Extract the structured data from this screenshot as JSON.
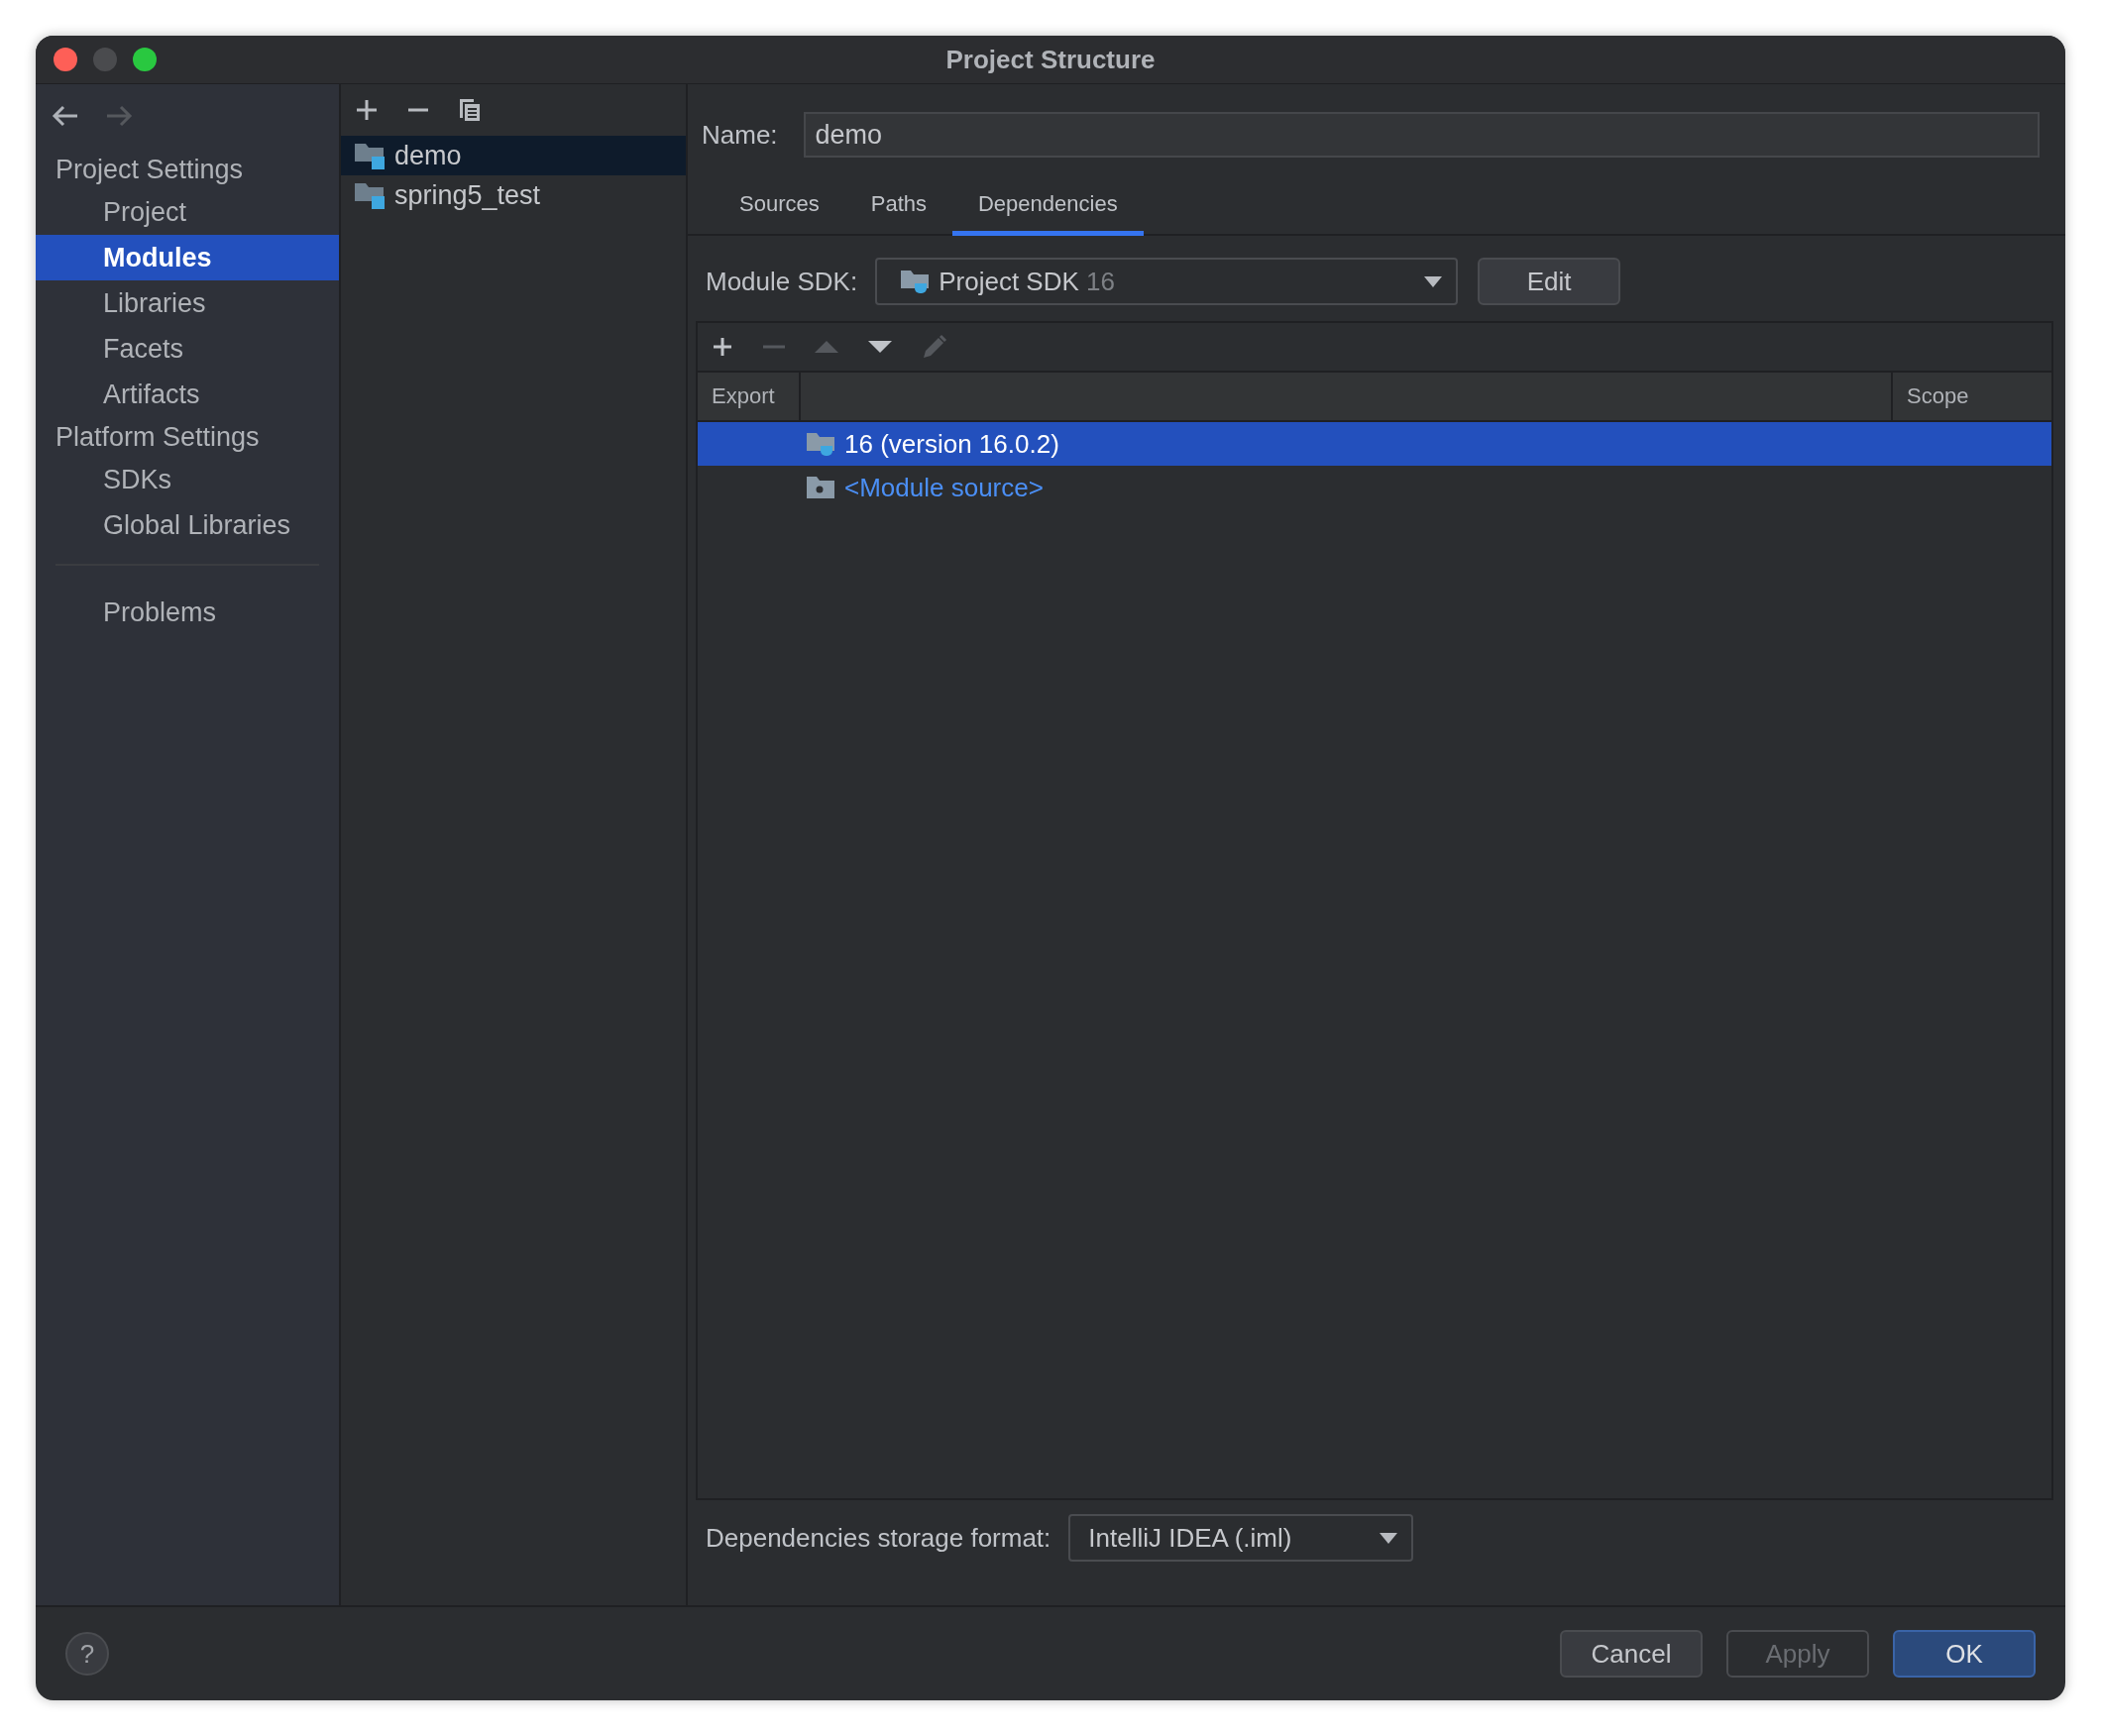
{
  "window": {
    "title": "Project Structure"
  },
  "sidebar": {
    "sections": [
      {
        "heading": "Project Settings",
        "items": [
          {
            "label": "Project",
            "selected": false
          },
          {
            "label": "Modules",
            "selected": true
          },
          {
            "label": "Libraries",
            "selected": false
          },
          {
            "label": "Facets",
            "selected": false
          },
          {
            "label": "Artifacts",
            "selected": false
          }
        ]
      },
      {
        "heading": "Platform Settings",
        "items": [
          {
            "label": "SDKs",
            "selected": false
          },
          {
            "label": "Global Libraries",
            "selected": false
          }
        ]
      }
    ],
    "problems": "Problems"
  },
  "modules": [
    {
      "name": "demo",
      "selected": true
    },
    {
      "name": "spring5_test",
      "selected": false
    }
  ],
  "name_field": {
    "label": "Name:",
    "value": "demo"
  },
  "tabs": [
    {
      "label": "Sources",
      "selected": false
    },
    {
      "label": "Paths",
      "selected": false
    },
    {
      "label": "Dependencies",
      "selected": true
    }
  ],
  "module_sdk": {
    "label": "Module SDK:",
    "value": "Project SDK",
    "version": "16",
    "edit": "Edit"
  },
  "dep_toolbar": [
    {
      "kind": "add",
      "disabled": false
    },
    {
      "kind": "remove",
      "disabled": true
    },
    {
      "kind": "up",
      "disabled": true
    },
    {
      "kind": "down",
      "disabled": false
    },
    {
      "kind": "edit",
      "disabled": true
    }
  ],
  "dependencies": {
    "columns": [
      "Export",
      "Scope"
    ],
    "rows": [
      {
        "kind": "sdk",
        "label": "16 (version 16.0.2)",
        "selected": true
      },
      {
        "kind": "source",
        "label": "<Module source>",
        "selected": false
      }
    ]
  },
  "storage": {
    "label": "Dependencies storage format:",
    "value": "IntelliJ IDEA (.iml)"
  },
  "help": "?",
  "buttons": [
    {
      "label": "Cancel",
      "kind": "normal",
      "disabled": false
    },
    {
      "label": "Apply",
      "kind": "normal",
      "disabled": true
    },
    {
      "label": "OK",
      "kind": "default",
      "disabled": false
    }
  ]
}
